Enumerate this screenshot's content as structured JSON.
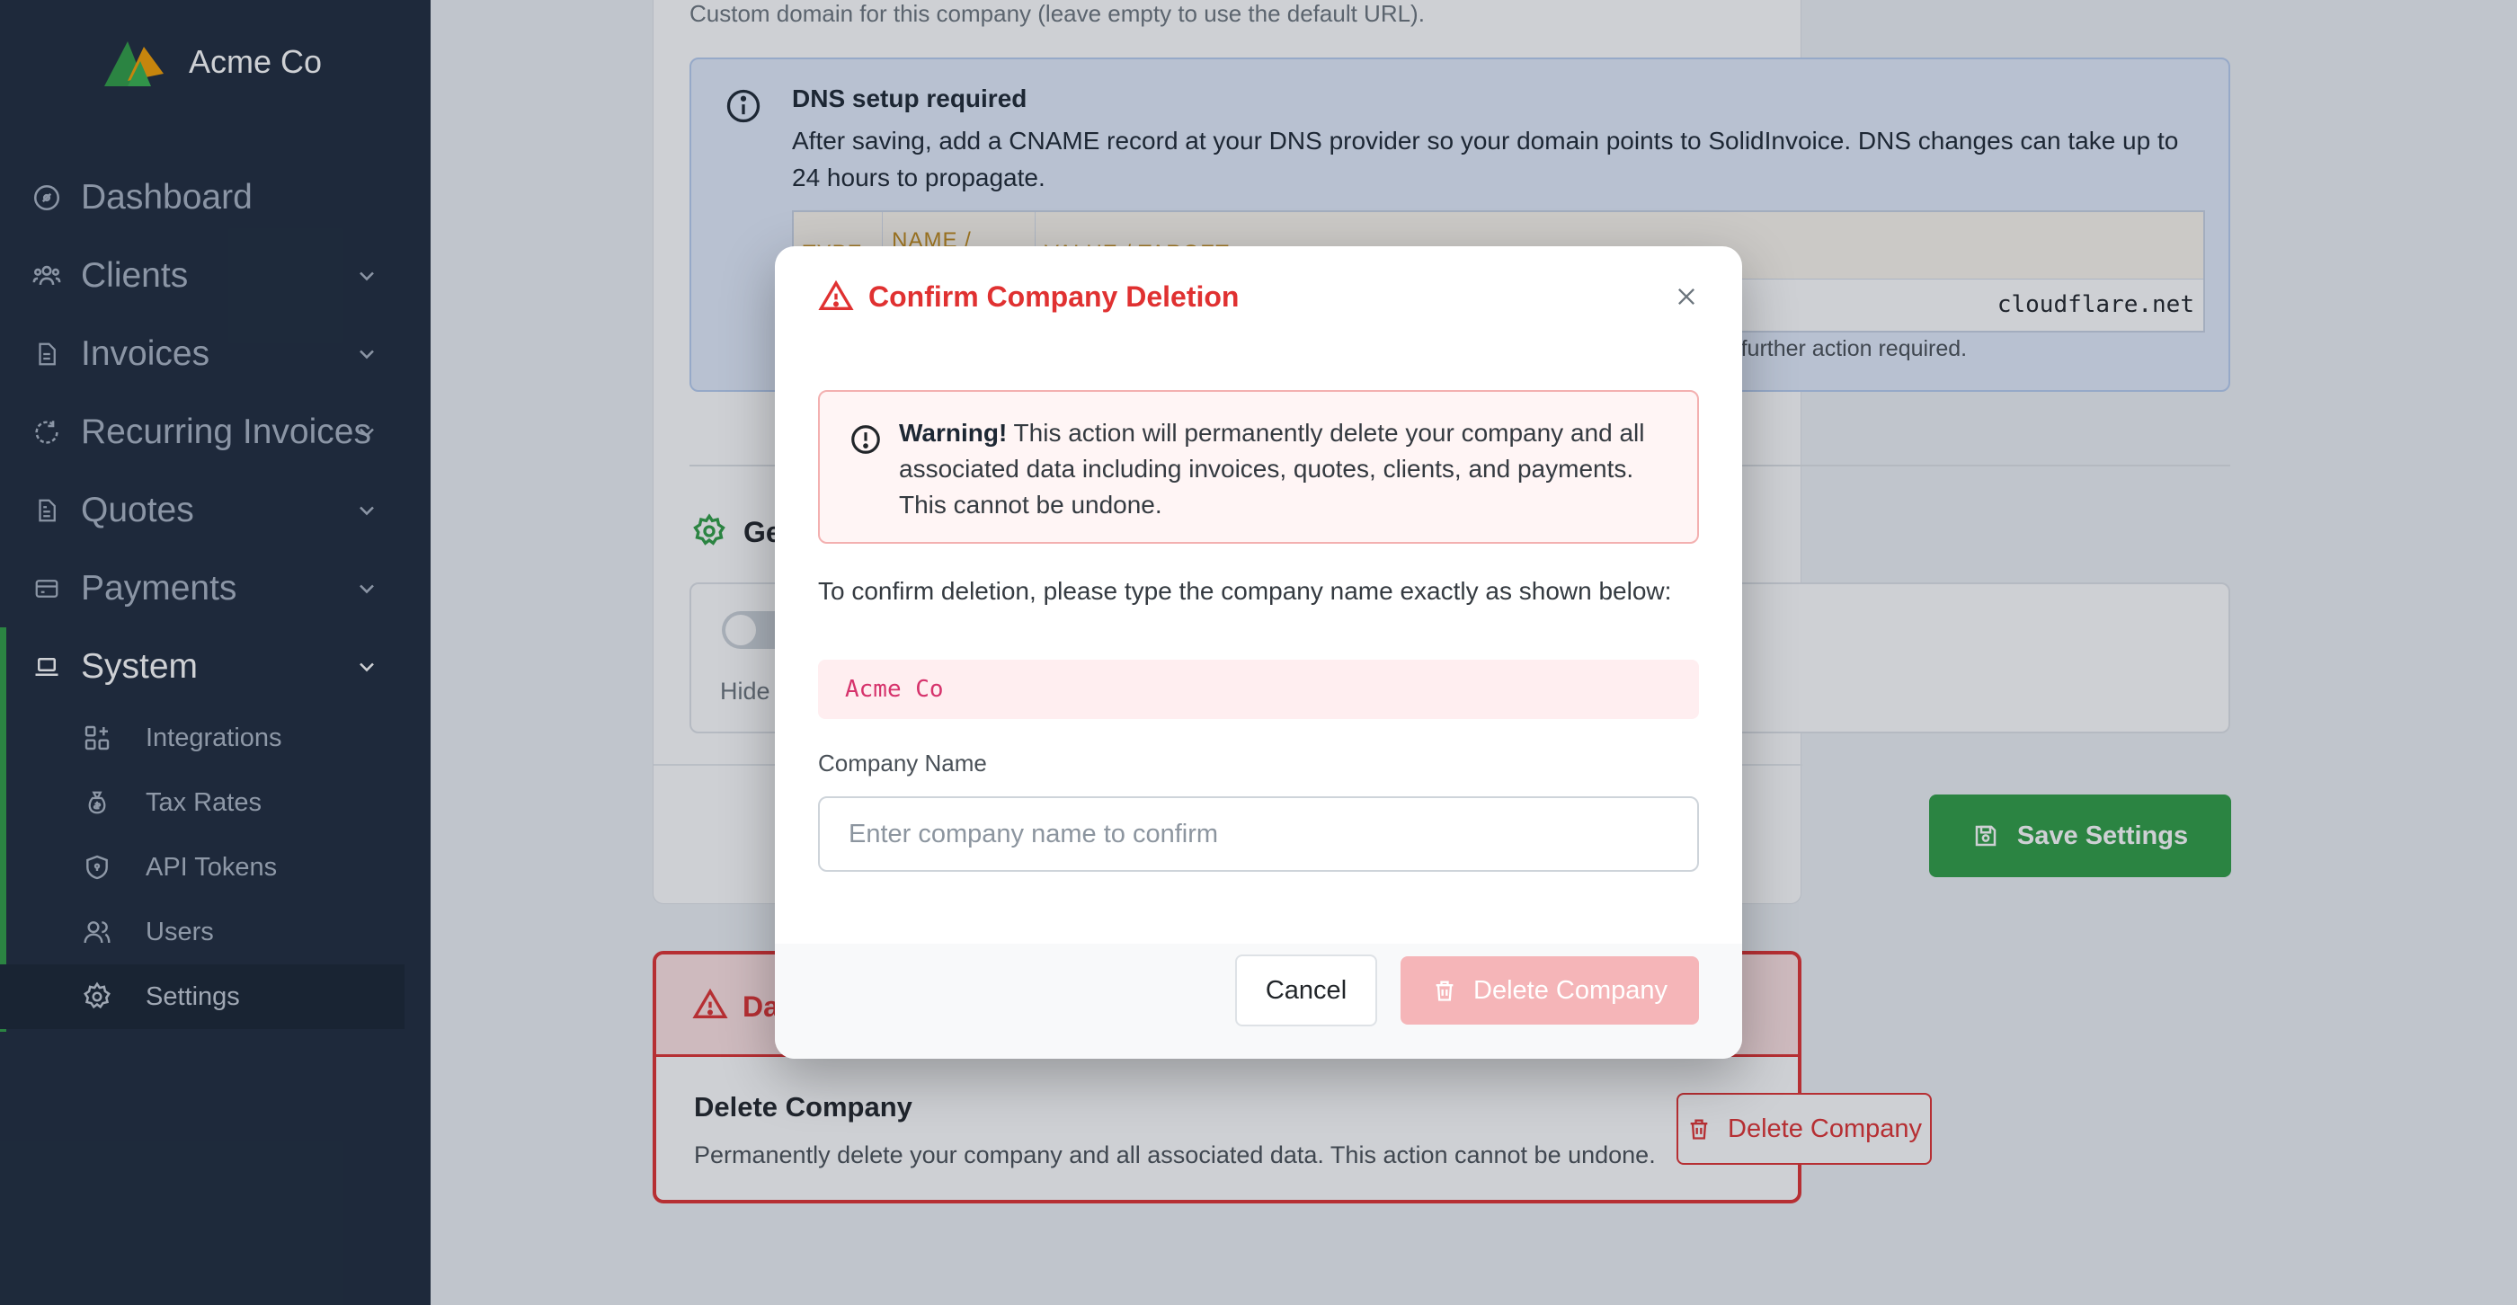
{
  "brand": {
    "name": "Acme Co"
  },
  "sidebar": {
    "items": [
      {
        "label": "Dashboard",
        "icon": "dashboard-icon",
        "has_chevron": false
      },
      {
        "label": "Clients",
        "icon": "users-icon",
        "has_chevron": true
      },
      {
        "label": "Invoices",
        "icon": "file-icon",
        "has_chevron": true
      },
      {
        "label": "Recurring Invoices",
        "icon": "refresh-icon",
        "has_chevron": true
      },
      {
        "label": "Quotes",
        "icon": "document-icon",
        "has_chevron": true
      },
      {
        "label": "Payments",
        "icon": "credit-card-icon",
        "has_chevron": true
      },
      {
        "label": "System",
        "icon": "laptop-icon",
        "has_chevron": true,
        "active": true
      }
    ],
    "system_subitems": [
      {
        "label": "Integrations",
        "icon": "apps-icon"
      },
      {
        "label": "Tax Rates",
        "icon": "money-bag-icon"
      },
      {
        "label": "API Tokens",
        "icon": "shield-icon"
      },
      {
        "label": "Users",
        "icon": "users-icon"
      },
      {
        "label": "Settings",
        "icon": "gear-icon",
        "active": true
      }
    ]
  },
  "page": {
    "domain_help": "Custom domain for this company (leave empty to use the default URL).",
    "dns": {
      "title": "DNS setup required",
      "body": "After saving, add a CNAME record at your DNS provider so your domain points to SolidInvoice. DNS changes can take up to 24 hours to propagate.",
      "columns": [
        "TYPE",
        "NAME / HOST",
        "VALUE / TARGET"
      ],
      "row_value": "cloudflare.net",
      "footnote": "– no further action required."
    },
    "general_title_partial": "Ge",
    "general_help_partial": "Hide",
    "save_button": "Save Settings",
    "danger": {
      "title_partial": "Da",
      "delete_title": "Delete Company",
      "delete_desc": "Permanently delete your company and all associated data. This action cannot be undone.",
      "delete_button": "Delete Company"
    }
  },
  "modal": {
    "title": "Confirm Company Deletion",
    "warning_strong": "Warning!",
    "warning_text": " This action will permanently delete your company and all associated data including invoices, quotes, clients, and payments. This cannot be undone.",
    "prompt": "To confirm deletion, please type the company name exactly as shown below:",
    "company_name": "Acme Co",
    "field_label": "Company Name",
    "field_placeholder": "Enter company name to confirm",
    "field_value": "",
    "cancel": "Cancel",
    "delete": "Delete Company"
  },
  "colors": {
    "sidebar_bg": "#1e2a3b",
    "accent_green": "#2f9e44",
    "danger_red": "#e03131"
  }
}
